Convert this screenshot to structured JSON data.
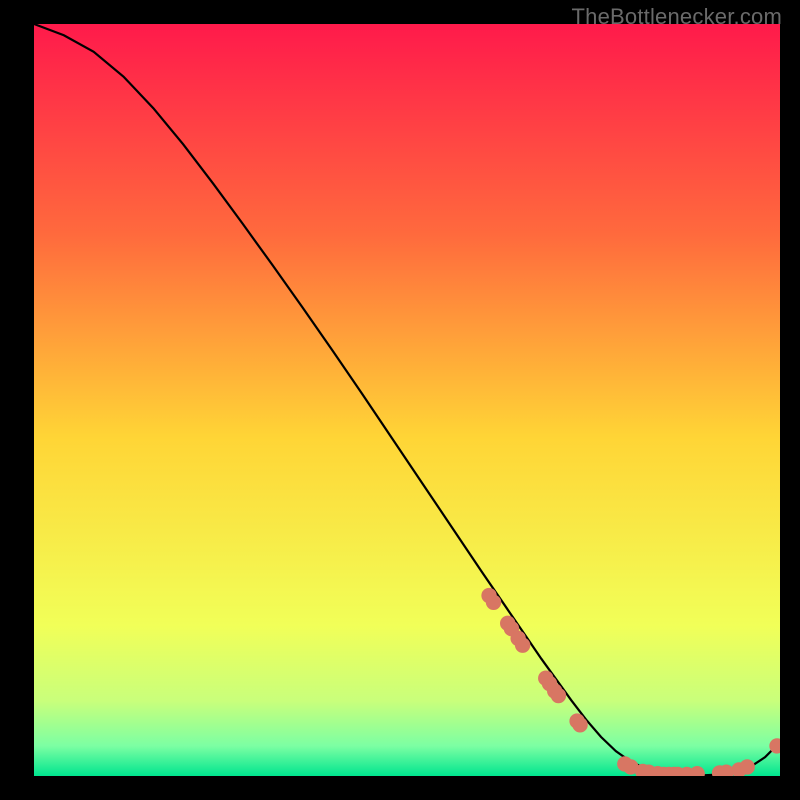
{
  "watermark": "TheBottlenecker.com",
  "gradient": {
    "top": "#ff1a4b",
    "q1": "#ff6a3d",
    "mid": "#ffd536",
    "q3low": "#f1ff58",
    "q3high": "#c9ff7b",
    "bottom_band_top": "#7cffa3",
    "bottom": "#00e58f"
  },
  "colors": {
    "curve": "#000000",
    "marker_fill": "#d87663",
    "marker_stroke": "#d87663"
  },
  "chart_data": {
    "type": "line",
    "title": "",
    "xlabel": "",
    "ylabel": "",
    "xlim": [
      0,
      100
    ],
    "ylim": [
      0,
      100
    ],
    "curve": {
      "x": [
        0,
        4,
        8,
        12,
        16,
        20,
        24,
        28,
        32,
        36,
        40,
        44,
        48,
        52,
        56,
        60,
        64,
        68,
        72,
        74,
        76,
        78,
        80,
        82,
        84,
        86,
        88,
        90,
        92,
        94,
        96,
        98,
        100
      ],
      "y": [
        100,
        98.5,
        96.3,
        93.0,
        88.8,
        84.0,
        78.8,
        73.4,
        67.9,
        62.3,
        56.6,
        50.8,
        44.9,
        39.0,
        33.1,
        27.2,
        21.4,
        15.6,
        10.1,
        7.5,
        5.2,
        3.3,
        1.9,
        1.0,
        0.5,
        0.2,
        0.1,
        0.1,
        0.2,
        0.5,
        1.2,
        2.5,
        4.5
      ]
    },
    "markers": [
      {
        "x": 61.0,
        "y": 24.0
      },
      {
        "x": 61.6,
        "y": 23.1
      },
      {
        "x": 63.5,
        "y": 20.3
      },
      {
        "x": 64.0,
        "y": 19.6
      },
      {
        "x": 64.9,
        "y": 18.3
      },
      {
        "x": 65.5,
        "y": 17.4
      },
      {
        "x": 68.6,
        "y": 13.0
      },
      {
        "x": 69.1,
        "y": 12.3
      },
      {
        "x": 69.8,
        "y": 11.3
      },
      {
        "x": 70.3,
        "y": 10.7
      },
      {
        "x": 72.8,
        "y": 7.3
      },
      {
        "x": 73.2,
        "y": 6.8
      },
      {
        "x": 79.2,
        "y": 1.6
      },
      {
        "x": 80.0,
        "y": 1.2
      },
      {
        "x": 81.6,
        "y": 0.6
      },
      {
        "x": 82.4,
        "y": 0.5
      },
      {
        "x": 83.6,
        "y": 0.3
      },
      {
        "x": 84.4,
        "y": 0.2
      },
      {
        "x": 85.1,
        "y": 0.2
      },
      {
        "x": 85.8,
        "y": 0.2
      },
      {
        "x": 86.3,
        "y": 0.2
      },
      {
        "x": 87.5,
        "y": 0.2
      },
      {
        "x": 88.9,
        "y": 0.3
      },
      {
        "x": 91.9,
        "y": 0.4
      },
      {
        "x": 92.8,
        "y": 0.5
      },
      {
        "x": 94.5,
        "y": 0.8
      },
      {
        "x": 95.6,
        "y": 1.2
      },
      {
        "x": 99.6,
        "y": 4.0
      }
    ]
  }
}
